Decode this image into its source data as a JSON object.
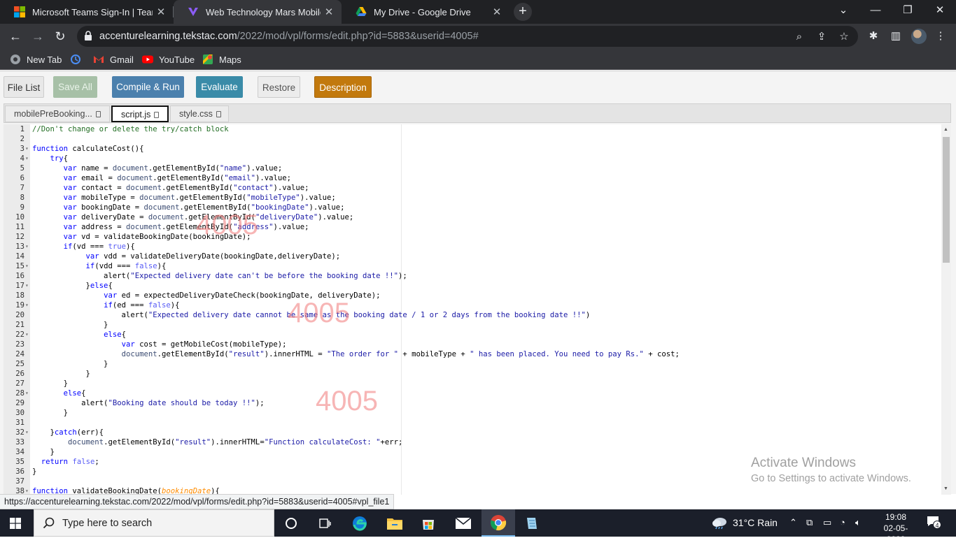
{
  "browser": {
    "tabs": [
      {
        "title": "Microsoft Teams Sign-In | Teams",
        "icon": "microsoft-icon"
      },
      {
        "title": "Web Technology Mars Mobiles C",
        "icon": "vpl-icon",
        "active": true
      },
      {
        "title": "My Drive - Google Drive",
        "icon": "google-drive-icon"
      }
    ],
    "new_tab": "+",
    "url_host": "accenturelearning.tekstac.com",
    "url_path": "/2022/mod/vpl/forms/edit.php?id=5883&userid=4005#",
    "bookmarks": [
      {
        "label": "New Tab",
        "icon": "globe-icon"
      },
      {
        "label": "",
        "icon": "history-icon"
      },
      {
        "label": "Gmail",
        "icon": "gmail-icon"
      },
      {
        "label": "YouTube",
        "icon": "youtube-icon"
      },
      {
        "label": "Maps",
        "icon": "maps-icon"
      }
    ]
  },
  "vpl": {
    "buttons": {
      "file_list": "File List",
      "save_all": "Save All",
      "compile_run": "Compile & Run",
      "evaluate": "Evaluate",
      "restore": "Restore",
      "description": "Description"
    },
    "colors": {
      "compile": "#4b80ad",
      "evaluate": "#3a8ba8",
      "description": "#c2790d",
      "save_disabled": "#a7c0a7"
    },
    "file_tabs": [
      "mobilePreBooking...",
      "script.js",
      "style.css"
    ],
    "active_file": "script.js"
  },
  "code_lines": [
    "//Don't change or delete the try/catch block",
    "",
    "function calculateCost(){",
    "    try{",
    "       var name = document.getElementById(\"name\").value;",
    "       var email = document.getElementById(\"email\").value;",
    "       var contact = document.getElementById(\"contact\").value;",
    "       var mobileType = document.getElementById(\"mobileType\").value;",
    "       var bookingDate = document.getElementById(\"bookingDate\").value;",
    "       var deliveryDate = document.getElementById(\"deliveryDate\").value;",
    "       var address = document.getElementById(\"address\").value;",
    "       var vd = validateBookingDate(bookingDate);",
    "       if(vd === true){",
    "            var vdd = validateDeliveryDate(bookingDate,deliveryDate);",
    "            if(vdd === false){",
    "                alert(\"Expected delivery date can't be before the booking date !!\");",
    "            }else{",
    "                var ed = expectedDeliveryDateCheck(bookingDate, deliveryDate);",
    "                if(ed === false){",
    "                    alert(\"Expected delivery date cannot be same as the booking date / 1 or 2 days from the booking date !!\")",
    "                }",
    "                else{",
    "                    var cost = getMobileCost(mobileType);",
    "                    document.getElementById(\"result\").innerHTML = \"The order for \" + mobileType + \" has been placed. You need to pay Rs.\" + cost;",
    "                }",
    "            }",
    "       }",
    "       else{",
    "           alert(\"Booking date should be today !!\");",
    "       }",
    "",
    "    }catch(err){",
    "        document.getElementById(\"result\").innerHTML=\"Function calculateCost: \"+err;",
    "    }",
    "  return false;",
    "}",
    "",
    "function validateBookingDate(bookingDate){"
  ],
  "fold_lines": [
    3,
    4,
    13,
    15,
    17,
    19,
    22,
    28,
    32,
    38
  ],
  "watermark_text": "4005",
  "windows_activation": {
    "title": "Activate Windows",
    "subtitle": "Go to Settings to activate Windows."
  },
  "status_url": "https://accenturelearning.tekstac.com/2022/mod/vpl/forms/edit.php?id=5883&userid=4005#vpl_file1",
  "taskbar": {
    "search_placeholder": "Type here to search",
    "weather": "31°C  Rain",
    "time": "19:08",
    "date": "02-05-2022",
    "notification_count": "4"
  }
}
